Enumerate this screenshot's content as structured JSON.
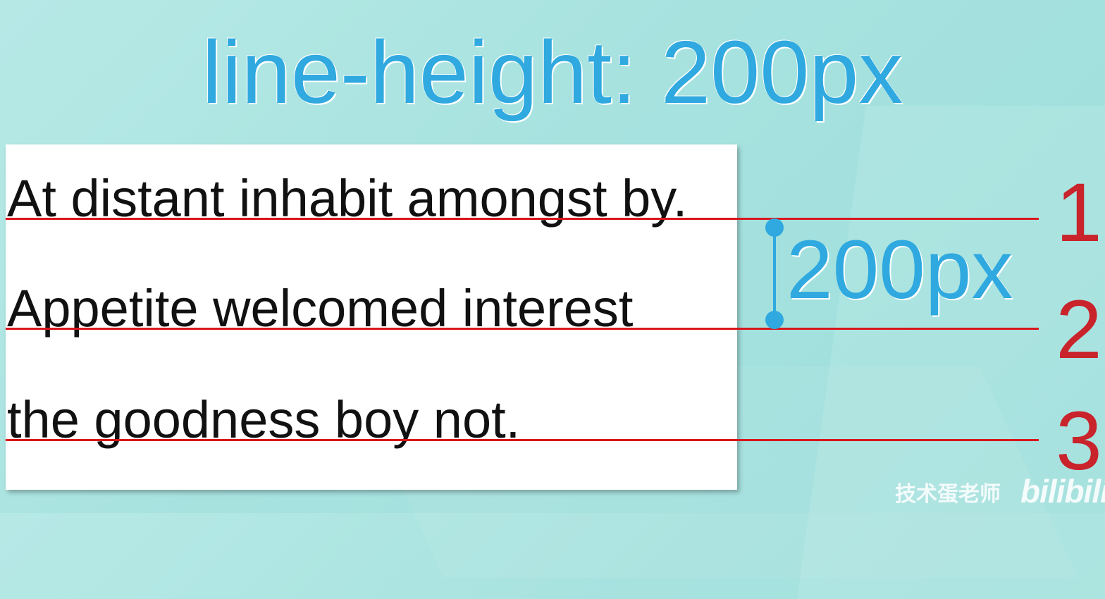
{
  "title": "line-height: 200px",
  "text_lines": [
    "At distant inhabit amongst by.",
    "Appetite welcomed interest",
    "the goodness boy not."
  ],
  "line_numbers": [
    "1",
    "2",
    "3"
  ],
  "measure_label": "200px",
  "watermark": {
    "author": "技术蛋老师",
    "logo": "bilibili"
  },
  "colors": {
    "title": "#2fa9df",
    "baseline": "#d9161c",
    "line_number": "#c9232b",
    "background": "#a7e2df"
  }
}
